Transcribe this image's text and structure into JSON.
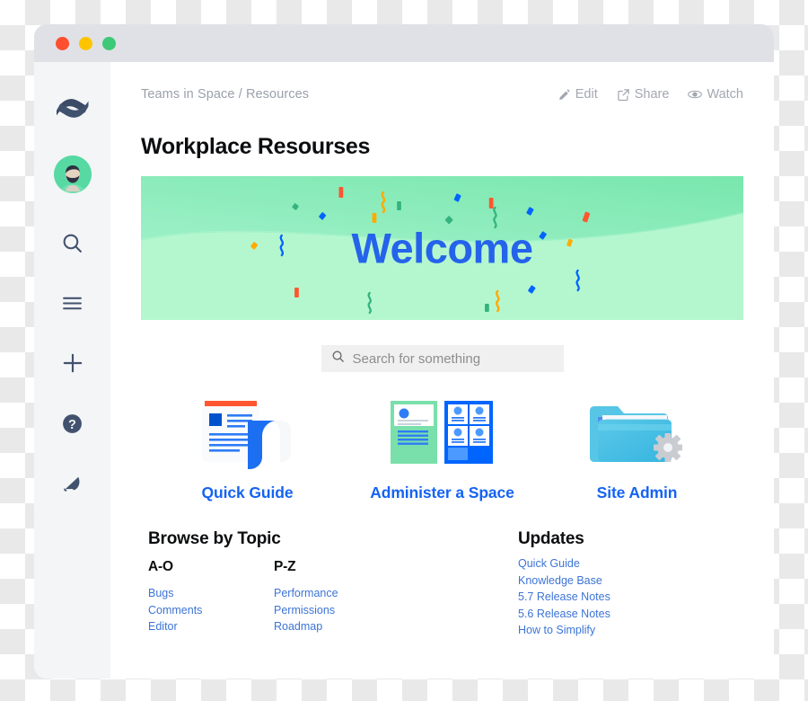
{
  "window": {
    "traffic_lights": [
      {
        "name": "close",
        "color": "#ff4f2f"
      },
      {
        "name": "minimize",
        "color": "#ffc400"
      },
      {
        "name": "maximize",
        "color": "#3dc977"
      }
    ]
  },
  "sidebar": {
    "logo": "confluence-logo",
    "avatar": "user-avatar",
    "items": [
      {
        "icon": "search-icon",
        "label": "Search"
      },
      {
        "icon": "hamburger-menu-icon",
        "label": "Menu"
      },
      {
        "icon": "plus-icon",
        "label": "Create"
      },
      {
        "icon": "help-icon",
        "label": "Help"
      },
      {
        "icon": "notification-bell-icon",
        "label": "Notifications"
      }
    ]
  },
  "header": {
    "breadcrumb": "Teams in Space / Resources",
    "title": "Workplace Resourses",
    "actions": [
      {
        "label": "Edit",
        "icon": "pencil-icon"
      },
      {
        "label": "Share",
        "icon": "share-icon"
      },
      {
        "label": "Watch",
        "icon": "eye-icon"
      }
    ]
  },
  "banner": {
    "text": "Welcome",
    "text_color": "#2563eb",
    "bg_light": "#b4f7cf",
    "bg_dark": "#7ee8b2"
  },
  "search": {
    "placeholder": "Search for something",
    "value": "",
    "icon": "search-icon"
  },
  "cards": [
    {
      "label": "Quick Guide",
      "art": "document-guide-illustration"
    },
    {
      "label": "Administer a Space",
      "art": "space-admin-illustration"
    },
    {
      "label": "Site Admin",
      "art": "folder-gear-illustration"
    }
  ],
  "browse": {
    "title": "Browse by Topic",
    "columns": [
      {
        "heading": "A-O",
        "links": [
          "Bugs",
          "Comments",
          "Editor"
        ]
      },
      {
        "heading": "P-Z",
        "links": [
          "Performance",
          "Permissions",
          "Roadmap"
        ]
      }
    ]
  },
  "updates": {
    "title": "Updates",
    "links": [
      "Quick Guide",
      "Knowledge Base",
      "5.7 Release Notes",
      "5.6 Release Notes",
      "How to Simplify"
    ]
  },
  "colors": {
    "link_blue": "#3c74d6",
    "card_blue": "#1463f3",
    "sidebar_bg": "#f4f5f7",
    "titlebar_bg": "#dfe1e6"
  }
}
